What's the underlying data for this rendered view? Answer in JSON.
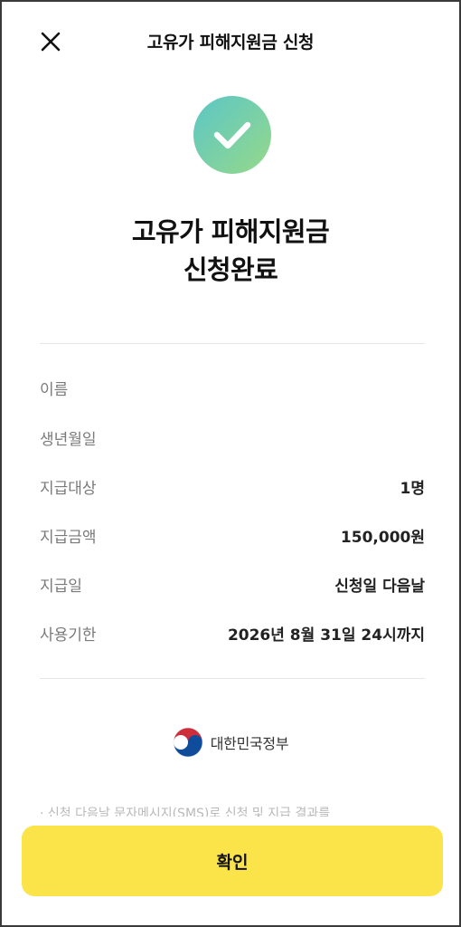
{
  "header": {
    "title": "고유가 피해지원금 신청",
    "close_icon": "close-icon"
  },
  "hero": {
    "icon": "check-icon",
    "gradient_start": "#5bc6c6",
    "gradient_end": "#96d98a",
    "title_line1": "고유가 피해지원금",
    "title_line2": "신청완료"
  },
  "details": [
    {
      "label": "이름",
      "value": ""
    },
    {
      "label": "생년월일",
      "value": ""
    },
    {
      "label": "지급대상",
      "value": "1명"
    },
    {
      "label": "지급금액",
      "value": "150,000원"
    },
    {
      "label": "지급일",
      "value": "신청일 다음날"
    },
    {
      "label": "사용기한",
      "value": "2026년 8월 31일 24시까지"
    }
  ],
  "footer": {
    "gov_name": "대한민국정부",
    "notice": "· 신청 다음날 문자메시지(SMS)로 신청 및 지급 결과를"
  },
  "actions": {
    "confirm_label": "확인",
    "confirm_color": "#fbe34a"
  }
}
